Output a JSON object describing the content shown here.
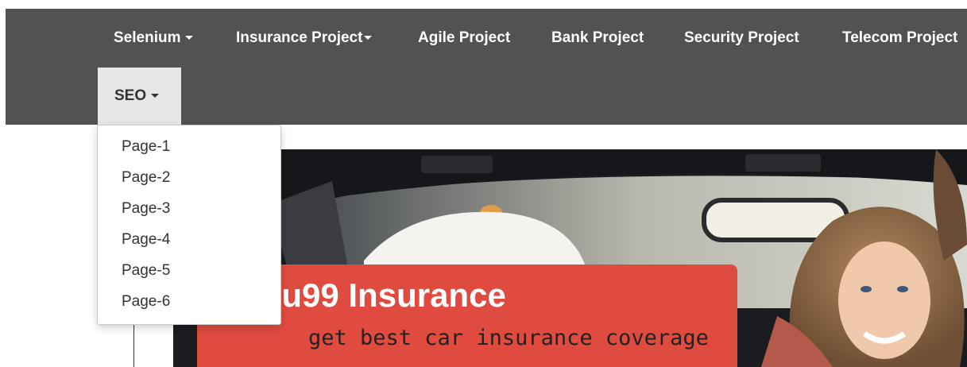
{
  "nav": {
    "items": [
      {
        "label": "Selenium",
        "has_dropdown": true
      },
      {
        "label": "Insurance Project",
        "has_dropdown": true
      },
      {
        "label": "Agile Project",
        "has_dropdown": false
      },
      {
        "label": "Bank Project",
        "has_dropdown": false
      },
      {
        "label": "Security Project",
        "has_dropdown": false
      },
      {
        "label": "Telecom Project",
        "has_dropdown": false
      }
    ],
    "seo": {
      "label": "SEO",
      "has_dropdown": true,
      "open": true
    }
  },
  "seo_menu": {
    "items": [
      "Page-1",
      "Page-2",
      "Page-3",
      "Page-4",
      "Page-5",
      "Page-6"
    ]
  },
  "hero": {
    "title": "ru99 Insurance",
    "subtitle": "get best car insurance coverage"
  },
  "colors": {
    "navbar": "#525252",
    "seo_active_tab": "#e6e6e6",
    "banner": "#e04b3f"
  }
}
